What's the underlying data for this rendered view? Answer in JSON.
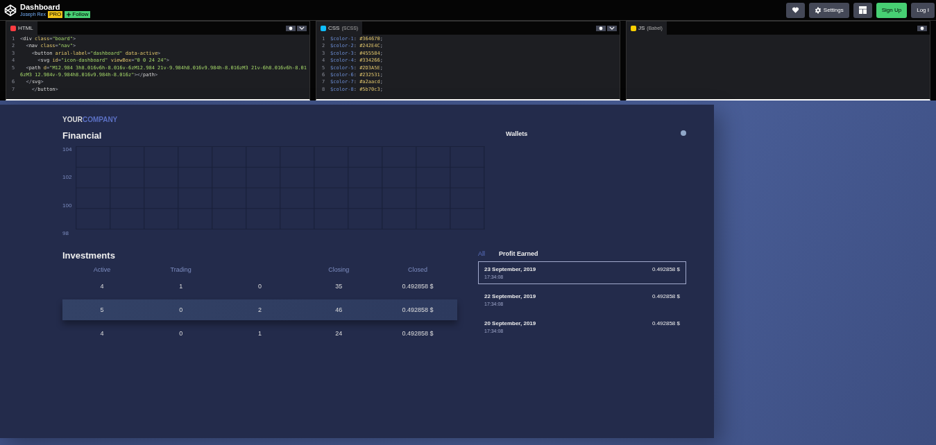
{
  "header": {
    "title": "Dashboard",
    "author": "Joseph Rex",
    "badge": "PRO",
    "follow": "Follow",
    "buttons": [
      {
        "kind": "heart"
      },
      {
        "kind": "settings",
        "label": "Settings"
      },
      {
        "kind": "layout"
      },
      {
        "kind": "signup",
        "label": "Sign Up"
      },
      {
        "kind": "login",
        "label": "Log I"
      }
    ]
  },
  "editors": [
    {
      "kind": "html",
      "name": "HTML",
      "lines": [
        {
          "number": "1",
          "tokens": [
            {
              "kind": "punct",
              "text": "<"
            },
            {
              "kind": "tag",
              "text": "div "
            },
            {
              "kind": "attr",
              "text": "class"
            },
            {
              "kind": "punct",
              "text": "="
            },
            {
              "kind": "string",
              "text": "\"board\""
            },
            {
              "kind": "punct",
              "text": ">"
            }
          ]
        },
        {
          "number": "2",
          "tokens": [
            {
              "kind": "punct",
              "text": "  <"
            },
            {
              "kind": "tag",
              "text": "nav "
            },
            {
              "kind": "attr",
              "text": "class"
            },
            {
              "kind": "punct",
              "text": "="
            },
            {
              "kind": "string",
              "text": "\"nav\""
            },
            {
              "kind": "punct",
              "text": ">"
            }
          ]
        },
        {
          "number": "3",
          "tokens": [
            {
              "kind": "punct",
              "text": "    <"
            },
            {
              "kind": "tag",
              "text": "button "
            },
            {
              "kind": "attr",
              "text": "arial-label"
            },
            {
              "kind": "punct",
              "text": "="
            },
            {
              "kind": "string",
              "text": "\"dashboard\""
            },
            {
              "kind": "attr",
              "text": " data-active"
            },
            {
              "kind": "punct",
              "text": ">"
            }
          ]
        },
        {
          "number": "4",
          "tokens": [
            {
              "kind": "punct",
              "text": "      <"
            },
            {
              "kind": "tag",
              "text": "svg "
            },
            {
              "kind": "attr",
              "text": "id"
            },
            {
              "kind": "punct",
              "text": "="
            },
            {
              "kind": "string",
              "text": "\"icon-dashboard\""
            },
            {
              "kind": "attr",
              "text": " viewBox"
            },
            {
              "kind": "punct",
              "text": "="
            },
            {
              "kind": "string",
              "text": "\"0 0 24 24\""
            },
            {
              "kind": "punct",
              "text": ">"
            }
          ]
        },
        {
          "number": "5",
          "tokens": [
            {
              "kind": "punct",
              "text": "  <"
            },
            {
              "kind": "tag",
              "text": "path "
            },
            {
              "kind": "attr",
              "text": "d"
            },
            {
              "kind": "punct",
              "text": "="
            },
            {
              "kind": "string",
              "text": "\"M12.984 3h8.016v6h-8.016v-6zM12.984 21v-9.984h8.016v9.984h-8.016zM3 21v-6h8.016v6h-8.016zM3 12.984v-9.984h8.016v9.984h-8.016z\""
            },
            {
              "kind": "punct",
              "text": "></"
            },
            {
              "kind": "tag",
              "text": "path"
            },
            {
              "kind": "punct",
              "text": ">"
            }
          ]
        },
        {
          "number": "6",
          "tokens": [
            {
              "kind": "punct",
              "text": "  </"
            },
            {
              "kind": "tag",
              "text": "svg"
            },
            {
              "kind": "punct",
              "text": ">"
            }
          ]
        },
        {
          "number": "7",
          "tokens": [
            {
              "kind": "punct",
              "text": "    </"
            },
            {
              "kind": "tag",
              "text": "button"
            },
            {
              "kind": "punct",
              "text": ">"
            }
          ]
        }
      ]
    },
    {
      "kind": "css",
      "name": "CSS",
      "sub": "(SCSS)",
      "lines": [
        {
          "number": "1",
          "tokens": [
            {
              "kind": "var",
              "text": "$color-1"
            },
            {
              "kind": "punct",
              "text": ": "
            },
            {
              "kind": "value",
              "text": "#364670"
            },
            {
              "kind": "punct",
              "text": ";"
            }
          ]
        },
        {
          "number": "2",
          "tokens": [
            {
              "kind": "var",
              "text": "$color-2"
            },
            {
              "kind": "punct",
              "text": ": "
            },
            {
              "kind": "value",
              "text": "#242E4C"
            },
            {
              "kind": "punct",
              "text": ";"
            }
          ]
        },
        {
          "number": "3",
          "tokens": [
            {
              "kind": "var",
              "text": "$color-3"
            },
            {
              "kind": "punct",
              "text": ": "
            },
            {
              "kind": "value",
              "text": "#455584"
            },
            {
              "kind": "punct",
              "text": ";"
            }
          ]
        },
        {
          "number": "4",
          "tokens": [
            {
              "kind": "var",
              "text": "$color-4"
            },
            {
              "kind": "punct",
              "text": ": "
            },
            {
              "kind": "value",
              "text": "#334266"
            },
            {
              "kind": "punct",
              "text": ";"
            }
          ]
        },
        {
          "number": "5",
          "tokens": [
            {
              "kind": "var",
              "text": "$color-5"
            },
            {
              "kind": "punct",
              "text": ": "
            },
            {
              "kind": "value",
              "text": "#2D3A5E"
            },
            {
              "kind": "punct",
              "text": ";"
            }
          ]
        },
        {
          "number": "6",
          "tokens": [
            {
              "kind": "var",
              "text": "$color-6"
            },
            {
              "kind": "punct",
              "text": ": "
            },
            {
              "kind": "value",
              "text": "#232531"
            },
            {
              "kind": "punct",
              "text": ";"
            }
          ]
        },
        {
          "number": "7",
          "tokens": [
            {
              "kind": "var",
              "text": "$color-7"
            },
            {
              "kind": "punct",
              "text": ": "
            },
            {
              "kind": "value",
              "text": "#a2aacd"
            },
            {
              "kind": "punct",
              "text": ";"
            }
          ]
        },
        {
          "number": "8",
          "tokens": [
            {
              "kind": "var",
              "text": "$color-8"
            },
            {
              "kind": "punct",
              "text": ": "
            },
            {
              "kind": "value",
              "text": "#5b70c3"
            },
            {
              "kind": "punct",
              "text": ";"
            }
          ]
        }
      ]
    },
    {
      "kind": "js",
      "name": "JS",
      "sub": "(Babel)"
    }
  ],
  "dashboard": {
    "brand_first": "YOUR",
    "brand_second": "COMPANY",
    "financial": {
      "title": "Financial",
      "y_labels": [
        "104",
        "102",
        "100",
        "98"
      ]
    },
    "wallets": {
      "title": "Wallets"
    },
    "investments": {
      "title": "Investments",
      "columns": [
        "Active",
        "Trading",
        "",
        "Closing",
        "Closed"
      ],
      "rows": [
        {
          "cells": [
            "4",
            "1",
            "0",
            "35",
            "0.492858 $"
          ],
          "selected": false
        },
        {
          "cells": [
            "5",
            "0",
            "2",
            "46",
            "0.492858 $"
          ],
          "selected": true
        },
        {
          "cells": [
            "4",
            "0",
            "1",
            "24",
            "0.492858 $"
          ],
          "selected": false
        }
      ]
    },
    "profit": {
      "title": "Profit Earned",
      "filter": "All",
      "items": [
        {
          "date": "23 September, 2019",
          "time": "17:34:08",
          "amount": "0.492858 $",
          "selected": true
        },
        {
          "date": "22 September, 2019",
          "time": "17:34:08",
          "amount": "0.492858 $",
          "selected": false
        },
        {
          "date": "20 September, 2019",
          "time": "17:34:08",
          "amount": "0.492858 $",
          "selected": false
        }
      ]
    }
  }
}
